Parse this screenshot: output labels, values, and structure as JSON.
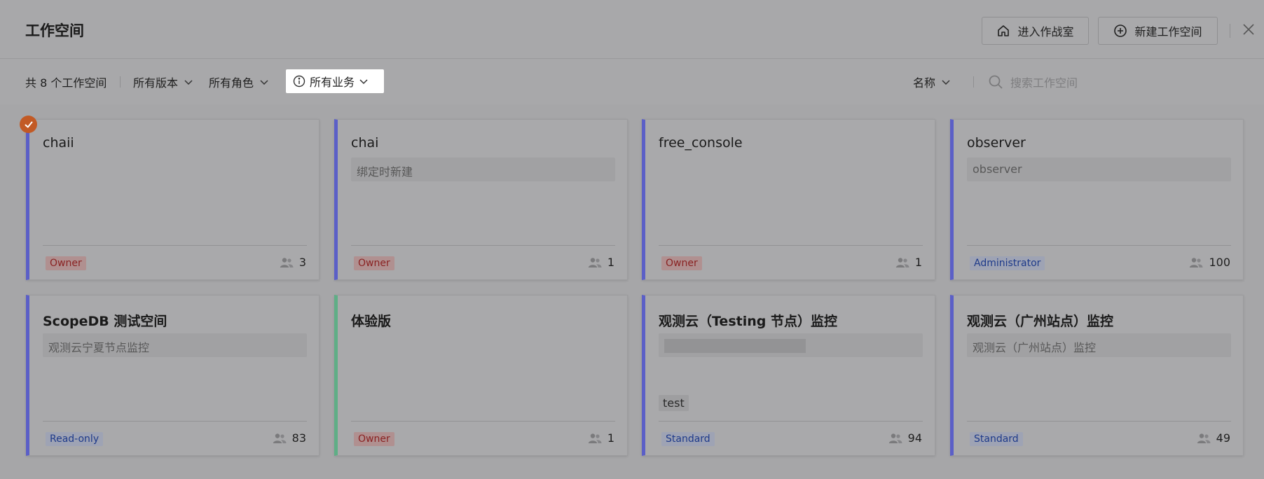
{
  "header": {
    "title": "工作空间",
    "btn_warroom": "进入作战室",
    "btn_new": "新建工作空间"
  },
  "filters": {
    "count_label": "共 8 个工作空间",
    "version": "所有版本",
    "role": "所有角色",
    "business": "所有业务",
    "sort": "名称",
    "search_placeholder": "搜索工作空间"
  },
  "colors": {
    "accent_blue": "#5b5fc7",
    "accent_green": "#5fae86",
    "selected_badge": "#c25a25",
    "owner_text": "#8a2222",
    "role_blue_text": "#1e3a8a"
  },
  "cards": [
    {
      "name": "chaii",
      "desc": "",
      "role": "Owner",
      "members": "3",
      "selected": true
    },
    {
      "name": "chai",
      "desc": "绑定时新建",
      "role": "Owner",
      "members": "1"
    },
    {
      "name": "free_console",
      "desc": "",
      "role": "Owner",
      "members": "1"
    },
    {
      "name": "observer",
      "desc": "observer",
      "role": "Administrator",
      "members": "100"
    },
    {
      "name": "ScopeDB 测试空间",
      "desc": "观测云宁夏节点监控",
      "role": "Read-only",
      "members": "83"
    },
    {
      "name": "体验版",
      "desc": "",
      "role": "Owner",
      "members": "1"
    },
    {
      "name": "观测云（Testing 节点）监控",
      "desc": "",
      "tag": "test",
      "role": "Standard",
      "members": "94"
    },
    {
      "name": "观测云（广州站点）监控",
      "desc": "观测云（广州站点）监控",
      "role": "Standard",
      "members": "49"
    }
  ]
}
